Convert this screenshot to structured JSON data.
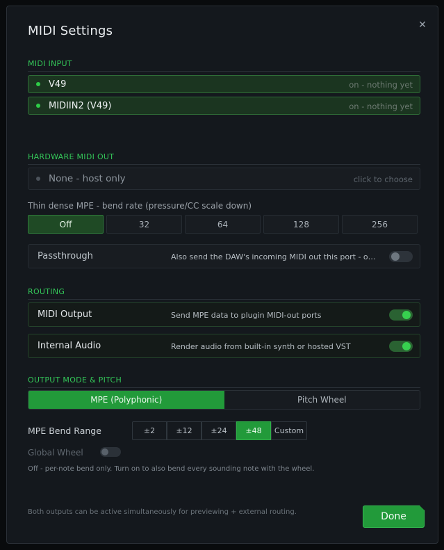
{
  "dialog": {
    "title": "MIDI Settings",
    "close_glyph": "✕"
  },
  "midi_input": {
    "header": "MIDI INPUT",
    "devices": [
      {
        "name": "V49",
        "state": "on - nothing yet"
      },
      {
        "name": "MIDIIN2 (V49)",
        "state": "on - nothing yet"
      }
    ]
  },
  "hardware_out": {
    "header": "HARDWARE MIDI OUT",
    "selected": "None - host only",
    "hint": "click to choose",
    "bend_rate_label": "Thin dense MPE - bend rate (pressure/CC scale down)",
    "bend_rates": [
      "Off",
      "32",
      "64",
      "128",
      "256"
    ],
    "bend_rate_selected": "Off",
    "passthrough": {
      "label": "Passthrough",
      "desc": "Also send the DAW's incoming MIDI out this port - o…",
      "enabled": false
    }
  },
  "routing": {
    "header": "ROUTING",
    "items": [
      {
        "label": "MIDI Output",
        "desc": "Send MPE data to plugin MIDI-out ports",
        "enabled": true
      },
      {
        "label": "Internal Audio",
        "desc": "Render audio from built-in synth or hosted VST",
        "enabled": true
      }
    ]
  },
  "output_mode": {
    "header": "OUTPUT MODE & PITCH",
    "modes": [
      "MPE (Polyphonic)",
      "Pitch Wheel"
    ],
    "mode_selected": "MPE (Polyphonic)",
    "bend_range_label": "MPE Bend Range",
    "bend_ranges": [
      "±2",
      "±12",
      "±24",
      "±48",
      "Custom"
    ],
    "bend_range_selected": "±48",
    "global_wheel_label": "Global Wheel",
    "global_wheel_enabled": false,
    "global_wheel_note": "Off - per-note bend only. Turn on to also bend every sounding note with the wheel."
  },
  "footer": {
    "note": "Both outputs can be active simultaneously for previewing + external routing.",
    "done_label": "Done"
  },
  "colors": {
    "accent": "#229a3a",
    "accent_text": "#34c759",
    "background": "#14181d"
  }
}
